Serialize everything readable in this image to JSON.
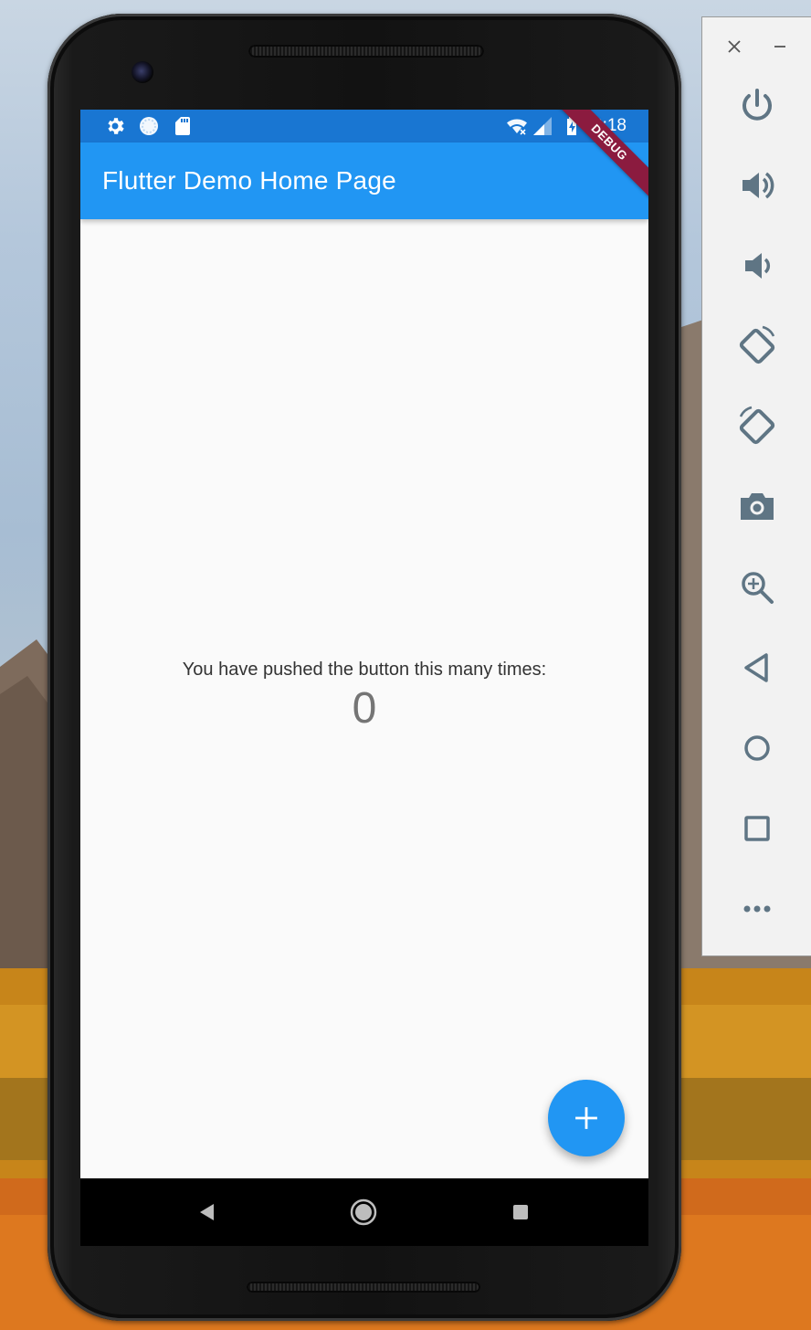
{
  "status_bar": {
    "time": "8:18",
    "left_icons": [
      "settings-icon",
      "sync-icon",
      "sd-card-icon"
    ],
    "right_icons": [
      "wifi-off-icon",
      "cell-signal-icon",
      "battery-charging-icon"
    ]
  },
  "app_bar": {
    "title": "Flutter Demo Home Page"
  },
  "debug_banner": {
    "label": "DEBUG"
  },
  "body": {
    "message": "You have pushed the button this many times:",
    "counter": "0"
  },
  "fab": {
    "icon": "add-icon"
  },
  "nav_bar": {
    "buttons": [
      "back-icon",
      "home-icon",
      "recents-icon"
    ]
  },
  "emulator_panel": {
    "window_controls": [
      "close-icon",
      "minimize-icon"
    ],
    "buttons": [
      "power-icon",
      "volume-up-icon",
      "volume-down-icon",
      "rotate-left-icon",
      "rotate-right-icon",
      "camera-icon",
      "zoom-icon",
      "back-icon",
      "home-icon",
      "overview-icon",
      "more-icon"
    ]
  },
  "colors": {
    "primary": "#2196f3",
    "primary_dark": "#1976d2",
    "debug_banner": "#8b1b3f",
    "panel_icon": "#5f7584"
  }
}
